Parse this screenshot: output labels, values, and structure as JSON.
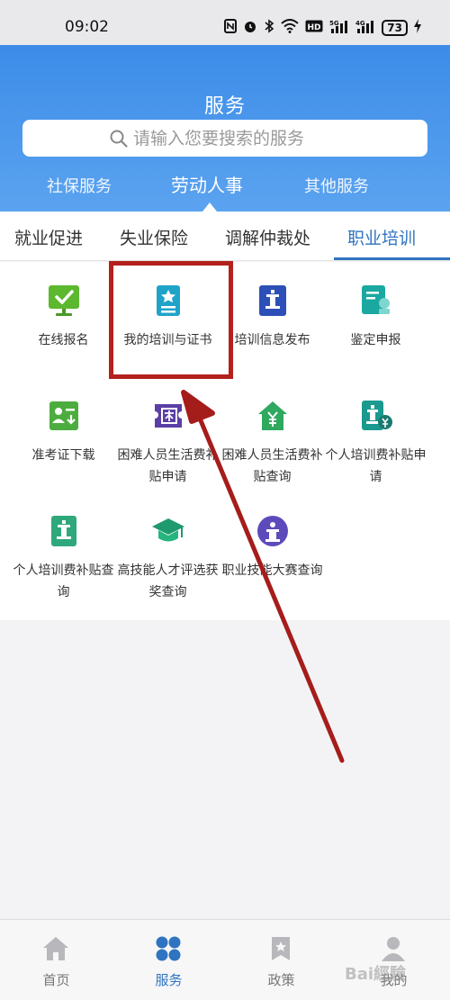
{
  "status_bar": {
    "time": "09:02",
    "battery": "73",
    "icons": [
      "nfc-icon",
      "alarm-icon",
      "bluetooth-icon",
      "wifi-icon",
      "hd-icon",
      "signal-5g-icon",
      "signal-4g-icon",
      "battery-icon",
      "charging-icon"
    ]
  },
  "header": {
    "title": "服务",
    "search_placeholder": "请输入您要搜索的服务",
    "tabs": [
      {
        "label": "社保服务",
        "active": false
      },
      {
        "label": "劳动人事",
        "active": true
      },
      {
        "label": "其他服务",
        "active": false
      }
    ]
  },
  "subtabs": [
    {
      "label": "就业促进",
      "active": false
    },
    {
      "label": "失业保险",
      "active": false
    },
    {
      "label": "调解仲裁处",
      "active": false
    },
    {
      "label": "职业培训",
      "active": true
    }
  ],
  "services": [
    {
      "label": "在线报名",
      "icon": "online-signup-icon"
    },
    {
      "label": "我的培训与证书",
      "icon": "certificate-icon"
    },
    {
      "label": "培训信息发布",
      "icon": "podium-icon"
    },
    {
      "label": "鉴定申报",
      "icon": "appraisal-icon"
    },
    {
      "label": "准考证下载",
      "icon": "admission-ticket-icon"
    },
    {
      "label": "困难人员生活费补贴申请",
      "icon": "hardship-ticket-icon"
    },
    {
      "label": "困难人员生活费补贴查询",
      "icon": "house-yuan-icon"
    },
    {
      "label": "个人培训费补贴申请",
      "icon": "training-subsidy-icon"
    },
    {
      "label": "个人培训费补贴查询",
      "icon": "training-query-icon"
    },
    {
      "label": "高技能人才评选获奖查询",
      "icon": "graduation-cap-icon"
    },
    {
      "label": "职业技能大赛查询",
      "icon": "contest-icon"
    }
  ],
  "bottom_nav": [
    {
      "label": "首页",
      "icon": "home-icon",
      "active": false
    },
    {
      "label": "服务",
      "icon": "services-icon",
      "active": true
    },
    {
      "label": "政策",
      "icon": "policy-icon",
      "active": false
    },
    {
      "label": "我的",
      "icon": "profile-icon",
      "active": false
    }
  ],
  "watermark": "Bai經驗",
  "colors": {
    "header_blue": "#3c8ce8",
    "active_blue": "#2f74c0",
    "highlight_red": "#b4201c"
  }
}
